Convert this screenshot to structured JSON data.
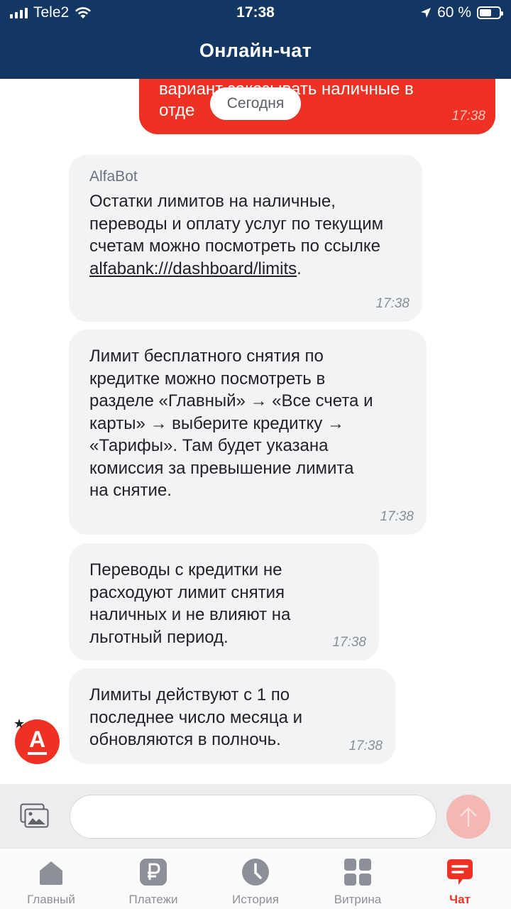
{
  "status_bar": {
    "carrier": "Tele2",
    "time": "17:38",
    "battery": "60 %",
    "battery_level": 0.6
  },
  "header": {
    "title": "Онлайн-чат"
  },
  "chat": {
    "user_message": {
      "text": "вариант заказывать наличные в отде",
      "time": "17:38"
    },
    "date_divider": "Сегодня",
    "messages": [
      {
        "sender": "AlfaBot",
        "text_before_link": "Остатки лимитов на наличные, переводы и оплату услуг по текущим счетам можно посмотреть по ссылке ",
        "link": "alfabank:///dashboard/limits",
        "text_after_link": ".",
        "time": "17:38"
      },
      {
        "text": "Лимит бесплатного снятия по кредитке можно посмотреть в разделе «Главный» → «Все счета и карты» → выберите кредитку → «Тарифы». Там будет указана комиссия за превышение лимита на снятие.",
        "time": "17:38"
      },
      {
        "text": "Переводы с кредитки не расходуют лимит снятия наличных и не влияют на льготный период.",
        "time": "17:38"
      },
      {
        "text": "Лимиты действуют с 1 по последнее число месяца и обновляются в полночь.",
        "time": "17:38"
      }
    ],
    "bot_avatar_letter": "А",
    "bot_avatar_badge": "★"
  },
  "input": {
    "value": "",
    "placeholder": ""
  },
  "tabs": [
    {
      "label": "Главный",
      "icon": "home-icon"
    },
    {
      "label": "Платежи",
      "icon": "ruble-icon"
    },
    {
      "label": "История",
      "icon": "clock-icon"
    },
    {
      "label": "Витрина",
      "icon": "grid-icon"
    },
    {
      "label": "Чат",
      "icon": "chat-icon",
      "active": true
    }
  ],
  "colors": {
    "header": "#133763",
    "accent": "#ef3124",
    "bubble": "#f2f3f5",
    "tab_inactive": "#8d9099"
  }
}
